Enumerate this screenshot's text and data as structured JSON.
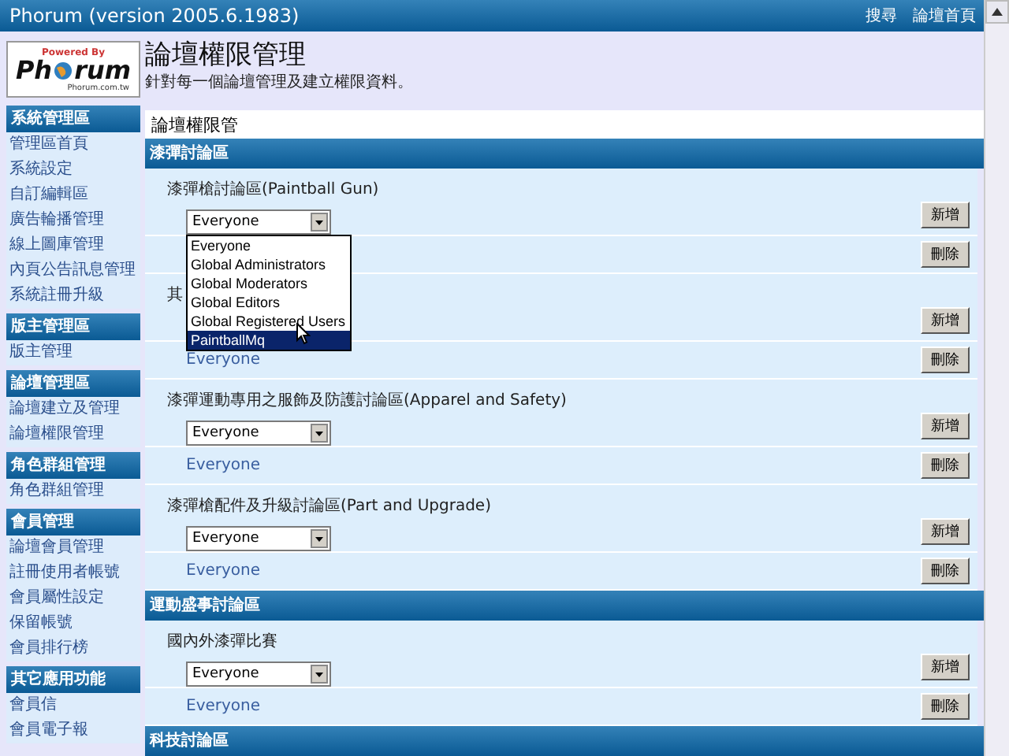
{
  "window": {
    "title": "Phorum (version 2005.6.1983)",
    "links": [
      "搜尋",
      "論壇首頁"
    ]
  },
  "logo": {
    "tagline": "Powered By",
    "name_start": "Ph",
    "name_end": "rum",
    "site": "Phorum.com.tw"
  },
  "sidebar": {
    "sections": [
      {
        "title": "系統管理區",
        "items": [
          "管理區首頁",
          "系統設定",
          "自訂編輯區",
          "廣告輪播管理",
          "線上圖庫管理",
          "內頁公告訊息管理",
          "系統註冊升級"
        ]
      },
      {
        "title": "版主管理區",
        "items": [
          "版主管理"
        ]
      },
      {
        "title": "論壇管理區",
        "items": [
          "論壇建立及管理",
          "論壇權限管理"
        ]
      },
      {
        "title": "角色群組管理",
        "items": [
          "角色群組管理"
        ]
      },
      {
        "title": "會員管理",
        "items": [
          "論壇會員管理",
          "註冊使用者帳號",
          "會員屬性設定",
          "保留帳號",
          "會員排行榜"
        ]
      },
      {
        "title": "其它應用功能",
        "items": [
          "會員信",
          "會員電子報"
        ]
      }
    ]
  },
  "page": {
    "title": "論壇權限管理",
    "subtitle": "針對每一個論壇管理及建立權限資料。"
  },
  "panel": {
    "title": "論壇權限管",
    "groups": [
      {
        "title": "漆彈討論區",
        "forums": [
          {
            "name": "漆彈槍討論區(Paintball Gun)",
            "select_value": "Everyone",
            "add_button": "新增",
            "remove_button": "刪除",
            "dropdown": {
              "options": [
                {
                  "label": "Everyone",
                  "selected": false
                },
                {
                  "label": "Global Administrators",
                  "selected": false
                },
                {
                  "label": "Global Moderators",
                  "selected": false
                },
                {
                  "label": "Global Editors",
                  "selected": false
                },
                {
                  "label": "Global Registered Users",
                  "selected": false
                },
                {
                  "label": "PaintballMq",
                  "selected": true
                }
              ]
            }
          },
          {
            "name": "其",
            "add_button": "新增",
            "members": "Everyone",
            "remove_button": "刪除"
          },
          {
            "name": "漆彈運動專用之服飾及防護討論區(Apparel and Safety)",
            "select_value": "Everyone",
            "add_button": "新增",
            "members": "Everyone",
            "remove_button": "刪除"
          },
          {
            "name": "漆彈槍配件及升級討論區(Part and Upgrade)",
            "select_value": "Everyone",
            "add_button": "新增",
            "members": "Everyone",
            "remove_button": "刪除"
          }
        ]
      },
      {
        "title": "運動盛事討論區",
        "forums": [
          {
            "name": "國內外漆彈比賽",
            "select_value": "Everyone",
            "add_button": "新增",
            "members": "Everyone",
            "remove_button": "刪除"
          }
        ]
      },
      {
        "title": "科技討論區"
      }
    ]
  }
}
